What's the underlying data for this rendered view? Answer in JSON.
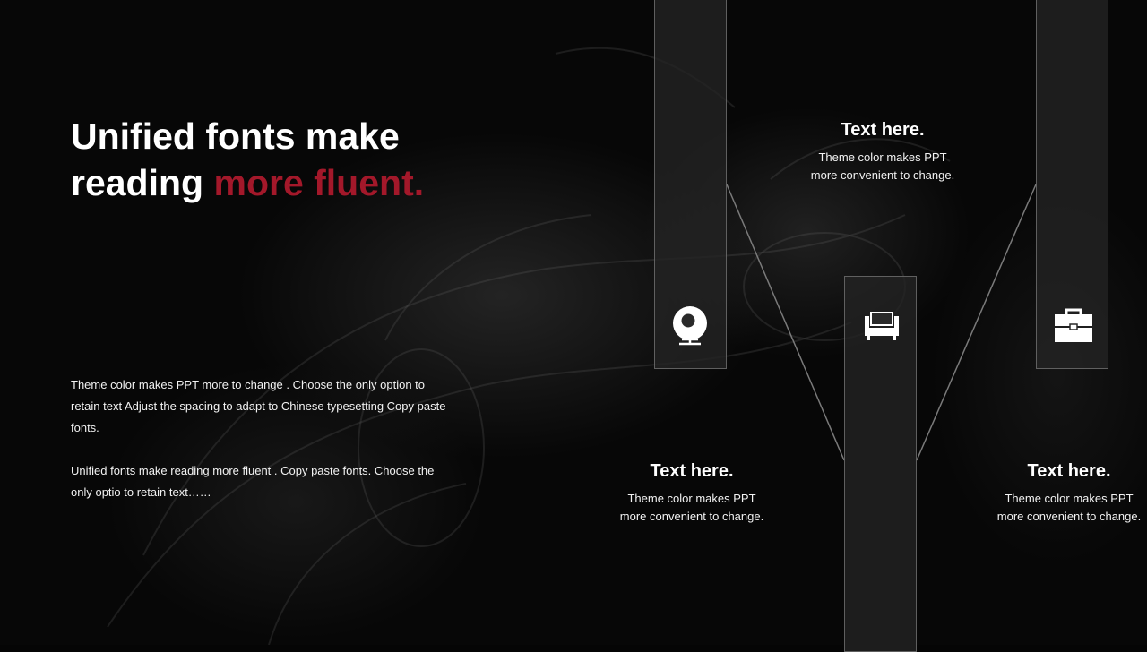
{
  "heading": {
    "line1": "Unified fonts make",
    "line2_plain": "reading ",
    "line2_accent": "more fluent."
  },
  "body": {
    "paragraph1": "Theme  color makes PPT more to change  . Choose the only option to retain text Adjust the spacing to adapt to Chinese  typesetting Copy paste fonts.",
    "paragraph2": "Unified  fonts make reading more fluent  . Copy paste fonts. Choose the only optio to retain text……"
  },
  "items": [
    {
      "icon": "webcam-icon",
      "title": "Text here.",
      "text": "Theme  color makes PPT more convenient to change."
    },
    {
      "icon": "armchair-icon",
      "title": "Text here.",
      "text": "Theme  color makes PPT more convenient to change."
    },
    {
      "icon": "toolbox-icon",
      "title": "Text here.",
      "text": "Theme  color makes PPT more convenient to change."
    }
  ],
  "colors": {
    "background": "#050505",
    "accent": "#a3182a",
    "text": "#ffffff"
  }
}
